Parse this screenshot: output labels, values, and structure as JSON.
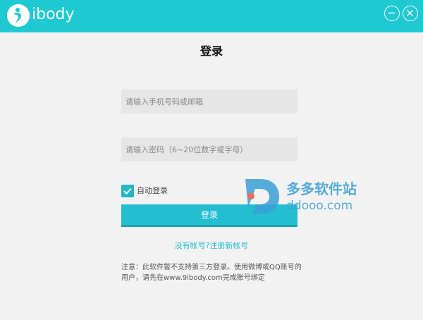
{
  "window": {
    "app_name": "ibody",
    "minimize_icon": "minimize-icon",
    "close_icon": "close-icon"
  },
  "login": {
    "title": "登录",
    "phone_placeholder": "请输入手机号码或邮箱",
    "password_placeholder": "请输入密码（6~20位数字或字母）",
    "remember_label": "自动登录",
    "remember_checked": true,
    "submit_label": "登录",
    "register_link": "没有帐号?注册新帐号",
    "notice": "注意：此软件暂不支持第三方登录。使用微博或QQ账号的用户，请先在www.9ibody.com完成账号绑定"
  },
  "watermark": {
    "title": "多多软件站",
    "url": "ddooo.com"
  },
  "colors": {
    "accent": "#1fc9d2",
    "button": "#23bed0",
    "background": "#f2f2f2",
    "field": "#e6e6e6"
  }
}
